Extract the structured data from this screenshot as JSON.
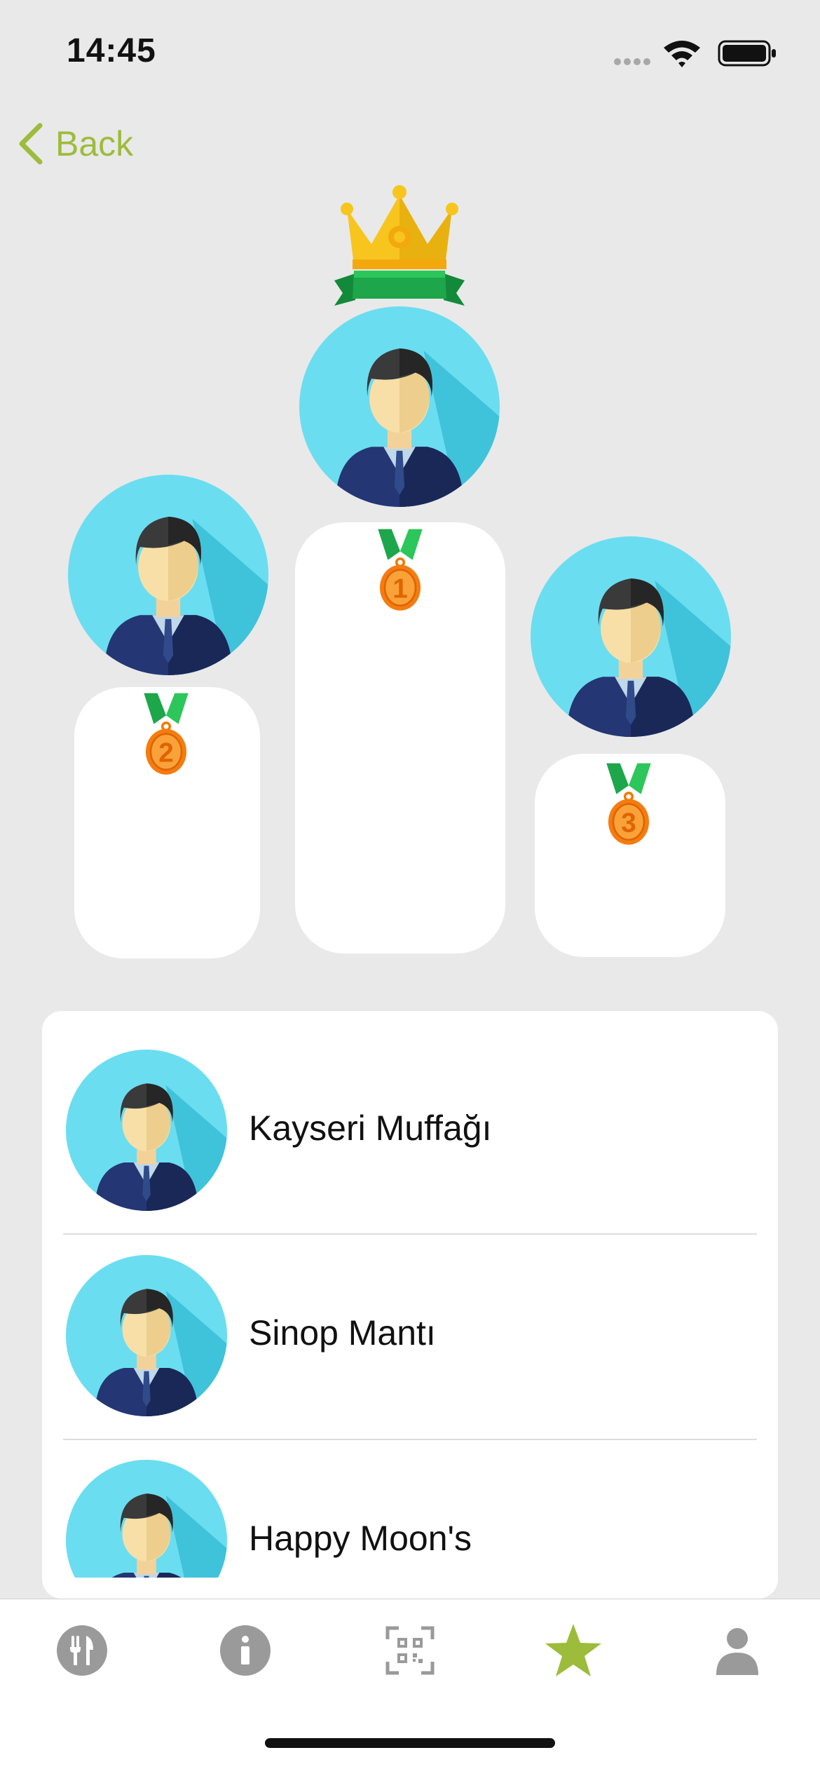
{
  "status_bar": {
    "time": "14:45",
    "icons": [
      "signal-icon",
      "wifi-icon",
      "battery-icon"
    ]
  },
  "nav": {
    "back_label": "Back",
    "back_icon": "chevron-left-icon",
    "accent": "#9DBC3B"
  },
  "podium": {
    "first": {
      "rank": "1",
      "icons": [
        "crown-icon",
        "avatar-icon",
        "medal-icon"
      ]
    },
    "second": {
      "rank": "2",
      "icons": [
        "avatar-icon",
        "medal-icon"
      ]
    },
    "third": {
      "rank": "3",
      "icons": [
        "avatar-icon",
        "medal-icon"
      ]
    }
  },
  "leaderboard": {
    "items": [
      {
        "name": "Kayseri Muffağı"
      },
      {
        "name": "Sinop Mantı"
      },
      {
        "name": "Happy Moon's"
      }
    ]
  },
  "tabbar": {
    "tabs": [
      {
        "icon": "restaurant-icon",
        "active": false
      },
      {
        "icon": "info-icon",
        "active": false
      },
      {
        "icon": "qr-scan-icon",
        "active": false
      },
      {
        "icon": "star-icon",
        "active": true
      },
      {
        "icon": "profile-icon",
        "active": false
      }
    ],
    "active_color": "#9DBC3B",
    "inactive_color": "#9A9A9A"
  }
}
